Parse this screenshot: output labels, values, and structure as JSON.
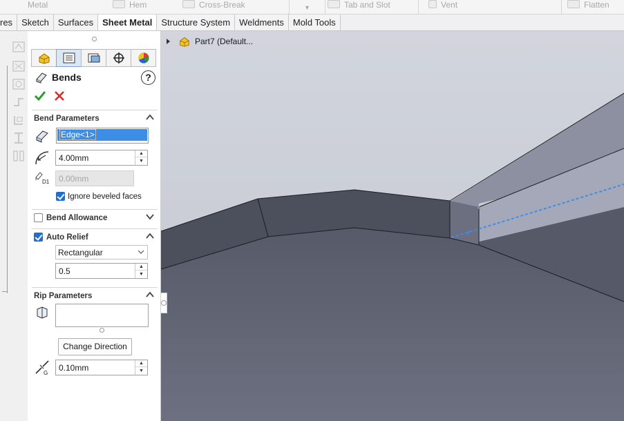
{
  "ribbon": {
    "items": [
      {
        "label": "Metal"
      },
      {
        "label": "Hem"
      },
      {
        "label": "Cross-Break"
      },
      {
        "label": "Tab and Slot"
      },
      {
        "label": "Vent"
      },
      {
        "label": "Flatten"
      }
    ]
  },
  "tabs": [
    {
      "label": "res",
      "active": false
    },
    {
      "label": "Sketch",
      "active": false
    },
    {
      "label": "Surfaces",
      "active": false
    },
    {
      "label": "Sheet Metal",
      "active": true
    },
    {
      "label": "Structure System",
      "active": false
    },
    {
      "label": "Weldments",
      "active": false
    },
    {
      "label": "Mold Tools",
      "active": false
    }
  ],
  "property_manager": {
    "title": "Bends",
    "help": "?",
    "bend_parameters": {
      "header": "Bend Parameters",
      "selection": "Edge<1>",
      "radius": "4.00mm",
      "d1_value": "0.00mm",
      "d1_label": "D1",
      "ignore_beveled_label": "Ignore beveled faces",
      "ignore_beveled_checked": true
    },
    "bend_allowance": {
      "header": "Bend Allowance",
      "checked": false
    },
    "auto_relief": {
      "header": "Auto Relief",
      "checked": true,
      "type": "Rectangular",
      "ratio": "0.5"
    },
    "rip_parameters": {
      "header": "Rip Parameters",
      "selection": "",
      "change_direction_label": "Change Direction",
      "gap": "0.10mm",
      "gap_label": "G"
    }
  },
  "feature_tree": {
    "part_label": "Part7 (Default..."
  },
  "colors": {
    "accent": "#1f6fd1",
    "selection_highlight": "#3c8de5",
    "ok_green": "#2e9b2e",
    "cancel_red": "#d42a2a",
    "model_dark": "#4c4f5c",
    "model_light": "#8e92a3",
    "viewport_bg": "#c8cbd4"
  }
}
